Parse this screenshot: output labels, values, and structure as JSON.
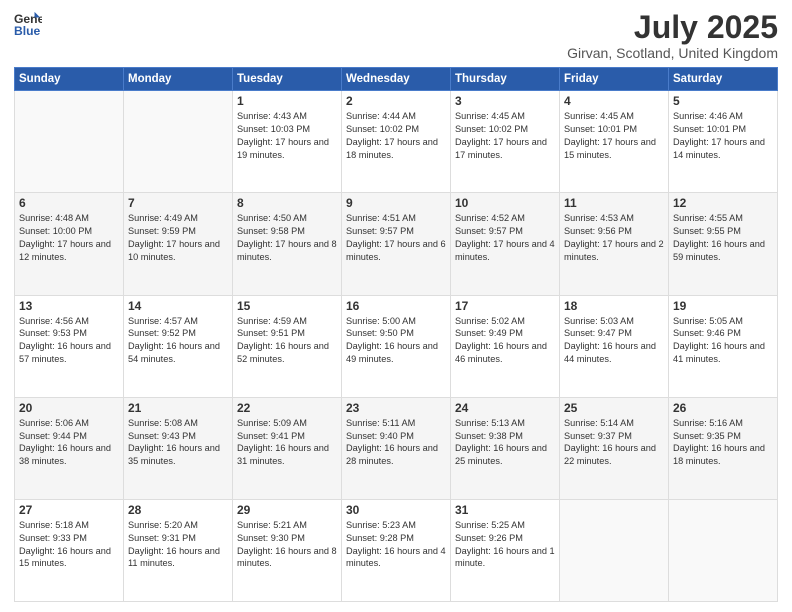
{
  "logo": {
    "general": "General",
    "blue": "Blue"
  },
  "header": {
    "month_title": "July 2025",
    "location": "Girvan, Scotland, United Kingdom"
  },
  "days_of_week": [
    "Sunday",
    "Monday",
    "Tuesday",
    "Wednesday",
    "Thursday",
    "Friday",
    "Saturday"
  ],
  "weeks": [
    [
      {
        "day": "",
        "sunrise": "",
        "sunset": "",
        "daylight": ""
      },
      {
        "day": "",
        "sunrise": "",
        "sunset": "",
        "daylight": ""
      },
      {
        "day": "1",
        "sunrise": "Sunrise: 4:43 AM",
        "sunset": "Sunset: 10:03 PM",
        "daylight": "Daylight: 17 hours and 19 minutes."
      },
      {
        "day": "2",
        "sunrise": "Sunrise: 4:44 AM",
        "sunset": "Sunset: 10:02 PM",
        "daylight": "Daylight: 17 hours and 18 minutes."
      },
      {
        "day": "3",
        "sunrise": "Sunrise: 4:45 AM",
        "sunset": "Sunset: 10:02 PM",
        "daylight": "Daylight: 17 hours and 17 minutes."
      },
      {
        "day": "4",
        "sunrise": "Sunrise: 4:45 AM",
        "sunset": "Sunset: 10:01 PM",
        "daylight": "Daylight: 17 hours and 15 minutes."
      },
      {
        "day": "5",
        "sunrise": "Sunrise: 4:46 AM",
        "sunset": "Sunset: 10:01 PM",
        "daylight": "Daylight: 17 hours and 14 minutes."
      }
    ],
    [
      {
        "day": "6",
        "sunrise": "Sunrise: 4:48 AM",
        "sunset": "Sunset: 10:00 PM",
        "daylight": "Daylight: 17 hours and 12 minutes."
      },
      {
        "day": "7",
        "sunrise": "Sunrise: 4:49 AM",
        "sunset": "Sunset: 9:59 PM",
        "daylight": "Daylight: 17 hours and 10 minutes."
      },
      {
        "day": "8",
        "sunrise": "Sunrise: 4:50 AM",
        "sunset": "Sunset: 9:58 PM",
        "daylight": "Daylight: 17 hours and 8 minutes."
      },
      {
        "day": "9",
        "sunrise": "Sunrise: 4:51 AM",
        "sunset": "Sunset: 9:57 PM",
        "daylight": "Daylight: 17 hours and 6 minutes."
      },
      {
        "day": "10",
        "sunrise": "Sunrise: 4:52 AM",
        "sunset": "Sunset: 9:57 PM",
        "daylight": "Daylight: 17 hours and 4 minutes."
      },
      {
        "day": "11",
        "sunrise": "Sunrise: 4:53 AM",
        "sunset": "Sunset: 9:56 PM",
        "daylight": "Daylight: 17 hours and 2 minutes."
      },
      {
        "day": "12",
        "sunrise": "Sunrise: 4:55 AM",
        "sunset": "Sunset: 9:55 PM",
        "daylight": "Daylight: 16 hours and 59 minutes."
      }
    ],
    [
      {
        "day": "13",
        "sunrise": "Sunrise: 4:56 AM",
        "sunset": "Sunset: 9:53 PM",
        "daylight": "Daylight: 16 hours and 57 minutes."
      },
      {
        "day": "14",
        "sunrise": "Sunrise: 4:57 AM",
        "sunset": "Sunset: 9:52 PM",
        "daylight": "Daylight: 16 hours and 54 minutes."
      },
      {
        "day": "15",
        "sunrise": "Sunrise: 4:59 AM",
        "sunset": "Sunset: 9:51 PM",
        "daylight": "Daylight: 16 hours and 52 minutes."
      },
      {
        "day": "16",
        "sunrise": "Sunrise: 5:00 AM",
        "sunset": "Sunset: 9:50 PM",
        "daylight": "Daylight: 16 hours and 49 minutes."
      },
      {
        "day": "17",
        "sunrise": "Sunrise: 5:02 AM",
        "sunset": "Sunset: 9:49 PM",
        "daylight": "Daylight: 16 hours and 46 minutes."
      },
      {
        "day": "18",
        "sunrise": "Sunrise: 5:03 AM",
        "sunset": "Sunset: 9:47 PM",
        "daylight": "Daylight: 16 hours and 44 minutes."
      },
      {
        "day": "19",
        "sunrise": "Sunrise: 5:05 AM",
        "sunset": "Sunset: 9:46 PM",
        "daylight": "Daylight: 16 hours and 41 minutes."
      }
    ],
    [
      {
        "day": "20",
        "sunrise": "Sunrise: 5:06 AM",
        "sunset": "Sunset: 9:44 PM",
        "daylight": "Daylight: 16 hours and 38 minutes."
      },
      {
        "day": "21",
        "sunrise": "Sunrise: 5:08 AM",
        "sunset": "Sunset: 9:43 PM",
        "daylight": "Daylight: 16 hours and 35 minutes."
      },
      {
        "day": "22",
        "sunrise": "Sunrise: 5:09 AM",
        "sunset": "Sunset: 9:41 PM",
        "daylight": "Daylight: 16 hours and 31 minutes."
      },
      {
        "day": "23",
        "sunrise": "Sunrise: 5:11 AM",
        "sunset": "Sunset: 9:40 PM",
        "daylight": "Daylight: 16 hours and 28 minutes."
      },
      {
        "day": "24",
        "sunrise": "Sunrise: 5:13 AM",
        "sunset": "Sunset: 9:38 PM",
        "daylight": "Daylight: 16 hours and 25 minutes."
      },
      {
        "day": "25",
        "sunrise": "Sunrise: 5:14 AM",
        "sunset": "Sunset: 9:37 PM",
        "daylight": "Daylight: 16 hours and 22 minutes."
      },
      {
        "day": "26",
        "sunrise": "Sunrise: 5:16 AM",
        "sunset": "Sunset: 9:35 PM",
        "daylight": "Daylight: 16 hours and 18 minutes."
      }
    ],
    [
      {
        "day": "27",
        "sunrise": "Sunrise: 5:18 AM",
        "sunset": "Sunset: 9:33 PM",
        "daylight": "Daylight: 16 hours and 15 minutes."
      },
      {
        "day": "28",
        "sunrise": "Sunrise: 5:20 AM",
        "sunset": "Sunset: 9:31 PM",
        "daylight": "Daylight: 16 hours and 11 minutes."
      },
      {
        "day": "29",
        "sunrise": "Sunrise: 5:21 AM",
        "sunset": "Sunset: 9:30 PM",
        "daylight": "Daylight: 16 hours and 8 minutes."
      },
      {
        "day": "30",
        "sunrise": "Sunrise: 5:23 AM",
        "sunset": "Sunset: 9:28 PM",
        "daylight": "Daylight: 16 hours and 4 minutes."
      },
      {
        "day": "31",
        "sunrise": "Sunrise: 5:25 AM",
        "sunset": "Sunset: 9:26 PM",
        "daylight": "Daylight: 16 hours and 1 minute."
      },
      {
        "day": "",
        "sunrise": "",
        "sunset": "",
        "daylight": ""
      },
      {
        "day": "",
        "sunrise": "",
        "sunset": "",
        "daylight": ""
      }
    ]
  ]
}
